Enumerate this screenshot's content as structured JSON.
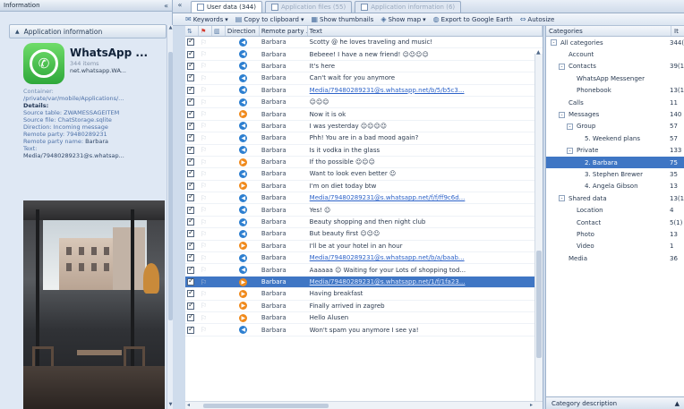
{
  "left_panel": {
    "header_title": "Information",
    "pin_glyph": "«",
    "section_title": "Application information",
    "app": {
      "name": "WhatsApp ...",
      "status": "344 items",
      "package": "net.whatsapp.WA..."
    },
    "container_label": "Container:",
    "container_value": "/private/var/mobile/Applications/...",
    "details_label": "Details:",
    "source_table": "Source table: ZWAMESSAGEITEM",
    "source_file": "Source file: ChatStorage.sqlite",
    "direction": "Direction: Incoming message",
    "remote_party": "Remote party: 79480289231",
    "remote_party_name_label": "Remote party name:",
    "remote_party_name": "Barbara",
    "text_label": "Text:",
    "media_link": "Media/79480289231@s.whatsap..."
  },
  "tabs": [
    {
      "label": "User data (344)",
      "active": true
    },
    {
      "label": "Application files (55)",
      "active": false
    },
    {
      "label": "Application information (6)",
      "active": false
    }
  ],
  "toolbar": {
    "keywords": "Keywords",
    "copy": "Copy to clipboard",
    "thumbnails": "Show thumbnails",
    "map": "Show map",
    "export": "Export to Google Earth",
    "autosize": "Autosize"
  },
  "grid": {
    "headers": [
      "",
      "",
      "",
      "Direction",
      "Remote party ...",
      "Text"
    ],
    "rows": [
      {
        "dir": "in",
        "party": "Barbara",
        "text": "Scotty @ he loves traveling and music!",
        "link": false
      },
      {
        "dir": "in",
        "party": "Barbara",
        "text": "Bebeee! I have a new friend! ☺☺☺☺",
        "link": false
      },
      {
        "dir": "in",
        "party": "Barbara",
        "text": "It's here",
        "link": false
      },
      {
        "dir": "in",
        "party": "Barbara",
        "text": "Can't wait for you anymore",
        "link": false
      },
      {
        "dir": "in",
        "party": "Barbara",
        "text": "Media/79480289231@s.whatsapp.net/b/5/b5c3...",
        "link": true
      },
      {
        "dir": "in",
        "party": "Barbara",
        "text": "☺☺☺",
        "link": false
      },
      {
        "dir": "out",
        "party": "Barbara",
        "text": "Now it is ok",
        "link": false
      },
      {
        "dir": "in",
        "party": "Barbara",
        "text": "I was yesterday ☺☺☺☺",
        "link": false
      },
      {
        "dir": "in",
        "party": "Barbara",
        "text": "Phh! You are in a bad mood again?",
        "link": false
      },
      {
        "dir": "in",
        "party": "Barbara",
        "text": "Is it vodka in the glass",
        "link": false
      },
      {
        "dir": "out",
        "party": "Barbara",
        "text": "If tho possible ☺☺☺",
        "link": false
      },
      {
        "dir": "in",
        "party": "Barbara",
        "text": "Want to look even better ☺",
        "link": false
      },
      {
        "dir": "out",
        "party": "Barbara",
        "text": "I'm on diet today btw",
        "link": false
      },
      {
        "dir": "in",
        "party": "Barbara",
        "text": "Media/79480289231@s.whatsapp.net/f/f/ff9c6d...",
        "link": true
      },
      {
        "dir": "in",
        "party": "Barbara",
        "text": "Yes! ☺",
        "link": false
      },
      {
        "dir": "in",
        "party": "Barbara",
        "text": "Beauty shopping and then night club",
        "link": false
      },
      {
        "dir": "in",
        "party": "Barbara",
        "text": "But beauty first ☺☺☺",
        "link": false
      },
      {
        "dir": "out",
        "party": "Barbara",
        "text": "I'll be at your hotel in an hour",
        "link": false
      },
      {
        "dir": "in",
        "party": "Barbara",
        "text": "Media/79480289231@s.whatsapp.net/b/a/baab...",
        "link": true
      },
      {
        "dir": "in",
        "party": "Barbara",
        "text": "Aaaaaa ☺ Waiting for your Lots of shopping tod...",
        "link": false
      },
      {
        "dir": "out",
        "party": "Barbara",
        "text": "Media/79480289231@s.whatsapp.net/1/f/1fa23...",
        "link": true,
        "selected": true
      },
      {
        "dir": "out",
        "party": "Barbara",
        "text": "Having breakfast",
        "link": false
      },
      {
        "dir": "out",
        "party": "Barbara",
        "text": "Finally arrived in zagreb",
        "link": false
      },
      {
        "dir": "out",
        "party": "Barbara",
        "text": "Hello Alusen",
        "link": false
      },
      {
        "dir": "in",
        "party": "Barbara",
        "text": "Won't spam you anymore I see ya!",
        "link": false
      }
    ]
  },
  "categories": {
    "header_label": "Categories",
    "header_col2": "It",
    "items": [
      {
        "label": "All categories",
        "count": "344(...",
        "indent": 0,
        "toggle": "-"
      },
      {
        "label": "Account",
        "count": "",
        "indent": 1
      },
      {
        "label": "Contacts",
        "count": "39(1)",
        "indent": 1,
        "toggle": "-"
      },
      {
        "label": "WhatsApp Messenger",
        "count": "",
        "indent": 2
      },
      {
        "label": "Phonebook",
        "count": "13(1)",
        "indent": 2
      },
      {
        "label": "Calls",
        "count": "11",
        "indent": 1
      },
      {
        "label": "Messages",
        "count": "140",
        "indent": 1,
        "toggle": "-"
      },
      {
        "label": "Group",
        "count": "57",
        "indent": 2,
        "toggle": "-"
      },
      {
        "label": "5. Weekend plans",
        "count": "57",
        "indent": 3
      },
      {
        "label": "Private",
        "count": "133",
        "indent": 2,
        "toggle": "-"
      },
      {
        "label": "2. Barbara",
        "count": "75",
        "indent": 3,
        "selected": true
      },
      {
        "label": "3. Stephen Brewer",
        "count": "35",
        "indent": 3
      },
      {
        "label": "4. Angela Gibson",
        "count": "13",
        "indent": 3
      },
      {
        "label": "Shared data",
        "count": "13(1)",
        "indent": 1,
        "toggle": "-"
      },
      {
        "label": "Location",
        "count": "4",
        "indent": 2
      },
      {
        "label": "Contact",
        "count": "5(1)",
        "indent": 2
      },
      {
        "label": "Photo",
        "count": "13",
        "indent": 2
      },
      {
        "label": "Video",
        "count": "1",
        "indent": 2
      },
      {
        "label": "Media",
        "count": "36",
        "indent": 1
      }
    ],
    "footer_label": "Category description"
  }
}
